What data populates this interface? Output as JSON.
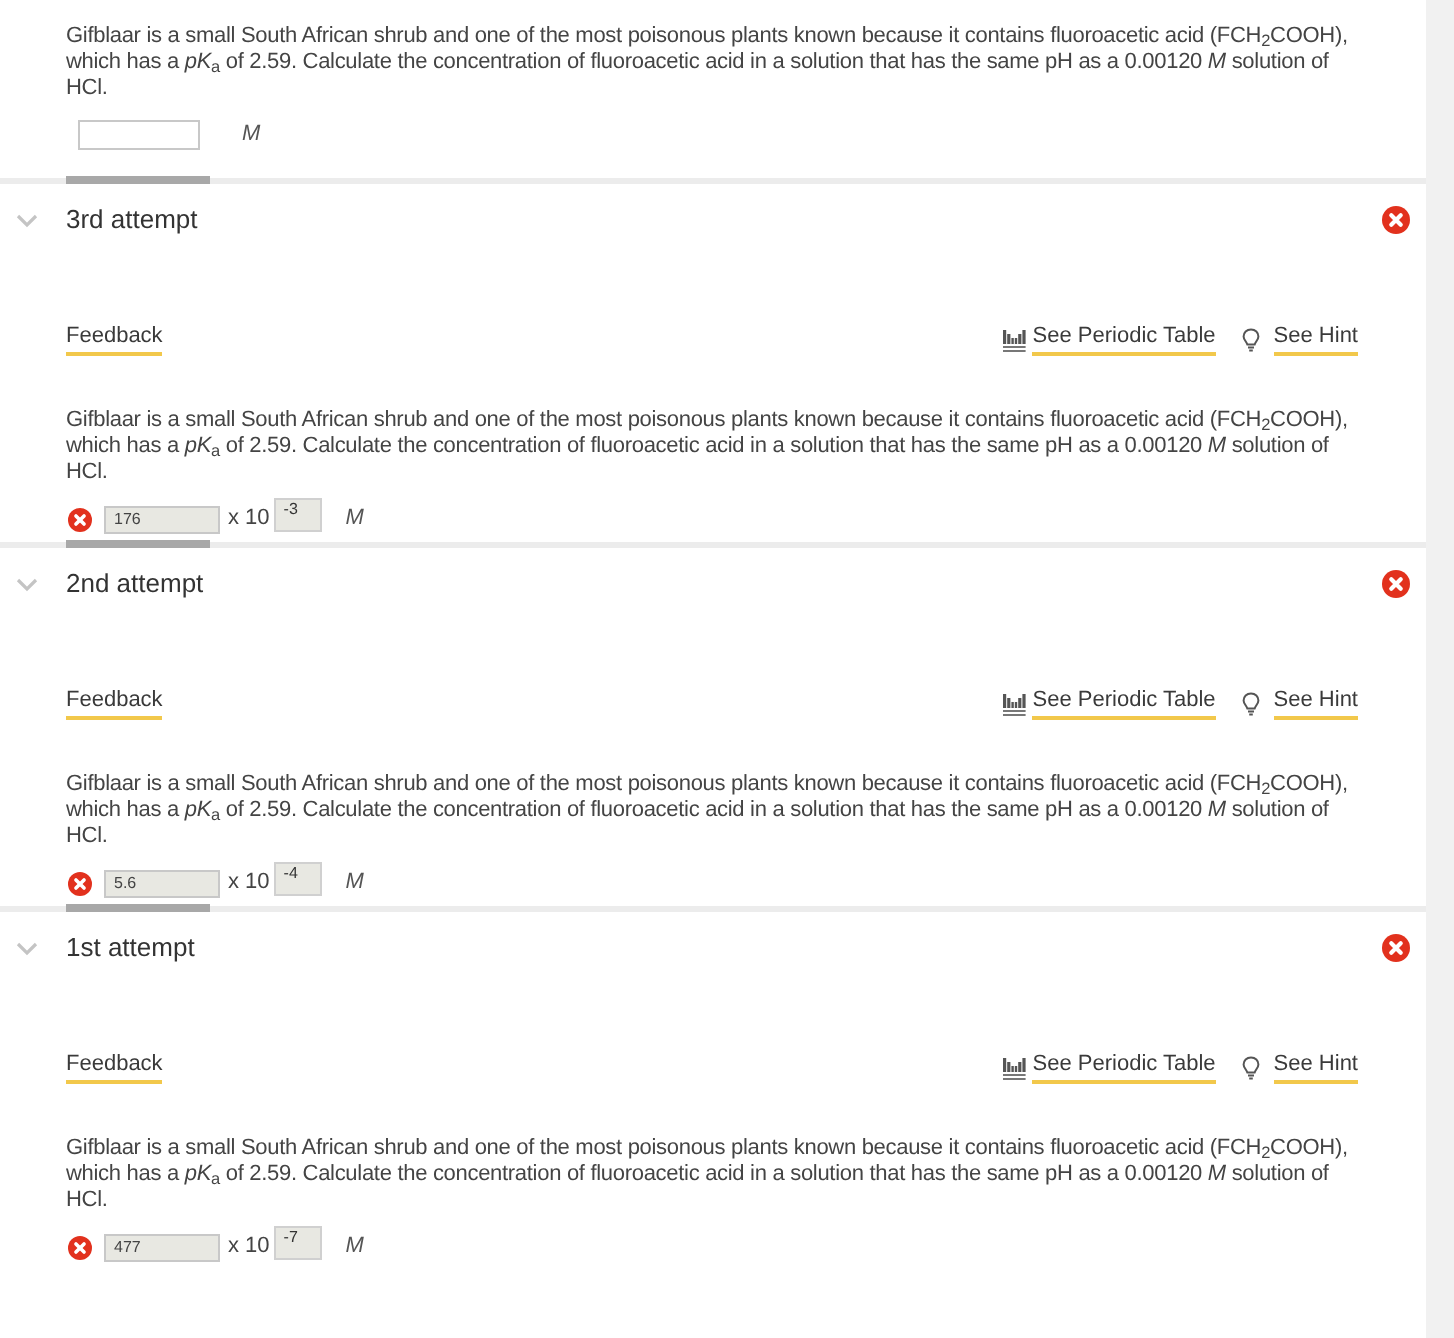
{
  "current": {
    "question": "Gifblaar is a small South African shrub and one of the most poisonous plants known because it contains fluoroacetic acid (FCH$_{2}$COOH), which has a *pK*$_{a}$ of 2.59. Calculate the concentration of fluoroacetic acid in a solution that has the same pH as a 0.00120 *M* solution of HCl.",
    "answer": {
      "disabled": false,
      "unit": "M"
    }
  },
  "attempts": [
    {
      "title": "3rd attempt",
      "expanded": true,
      "correct": false,
      "feedback": "Feedback",
      "periodic_table": "See Periodic Table",
      "hint": "See Hint",
      "question": "Gifblaar is a small South African shrub and one of the most poisonous plants known because it contains fluoroacetic acid (FCH$_{2}$COOH), which has a *pK*$_{a}$ of 2.59. Calculate the concentration of fluoroacetic acid in a solution that has the same pH as a 0.00120 *M* solution of HCl.",
      "answer": {
        "value": "176",
        "multiplier": "x 10",
        "exponent": "-3",
        "unit": "M",
        "disabled": true
      }
    },
    {
      "title": "2nd attempt",
      "expanded": true,
      "correct": false,
      "feedback": "Feedback",
      "periodic_table": "See Periodic Table",
      "hint": "See Hint",
      "question": "Gifblaar is a small South African shrub and one of the most poisonous plants known because it contains fluoroacetic acid (FCH$_{2}$COOH), which has a *pK*$_{a}$ of 2.59. Calculate the concentration of fluoroacetic acid in a solution that has the same pH as a 0.00120 *M* solution of HCl.",
      "answer": {
        "value": "5.6",
        "multiplier": "x 10",
        "exponent": "-4",
        "unit": "M",
        "disabled": true
      }
    },
    {
      "title": "1st attempt",
      "expanded": true,
      "correct": false,
      "feedback": "Feedback",
      "periodic_table": "See Periodic Table",
      "hint": "See Hint",
      "question": "Gifblaar is a small South African shrub and one of the most poisonous plants known because it contains fluoroacetic acid (FCH$_{2}$COOH), which has a *pK*$_{a}$ of 2.59. Calculate the concentration of fluoroacetic acid in a solution that has the same pH as a 0.00120 *M* solution of HCl.",
      "answer": {
        "value": "477",
        "multiplier": "x 10",
        "exponent": "-7",
        "unit": "M",
        "disabled": true
      }
    }
  ]
}
